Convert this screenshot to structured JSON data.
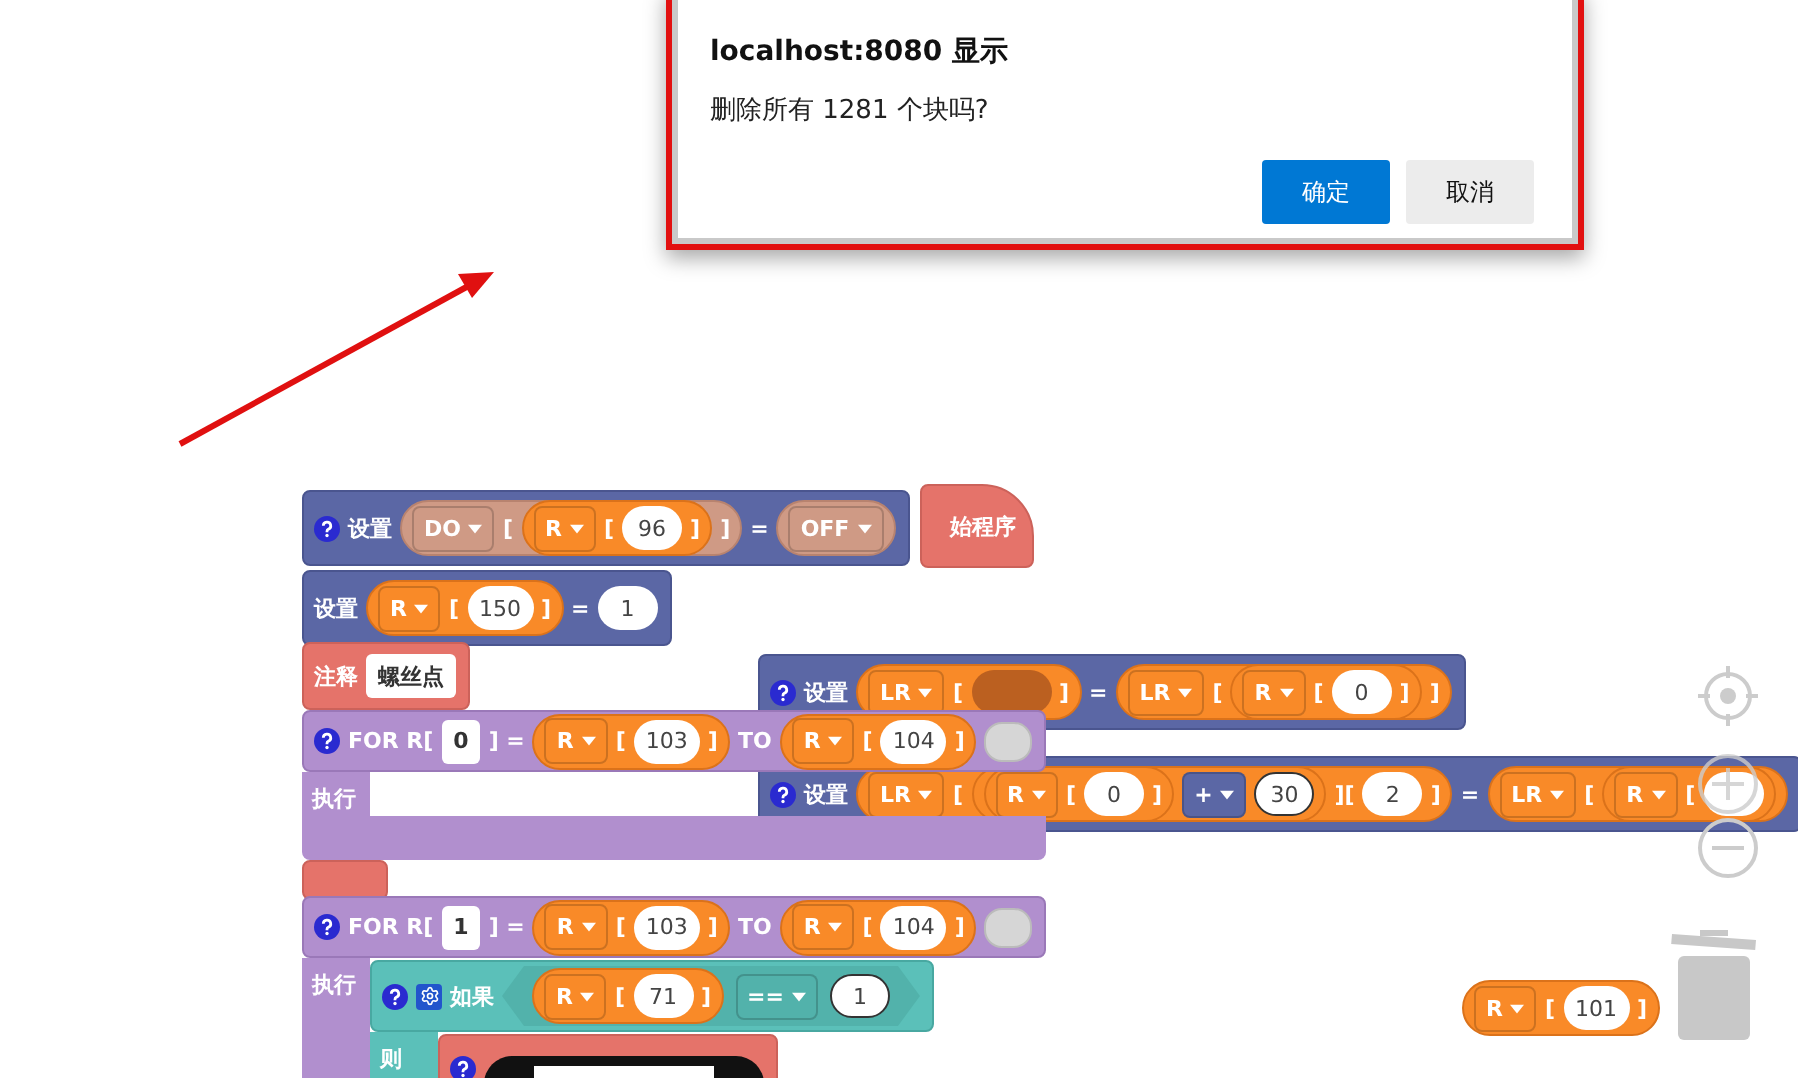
{
  "dialog": {
    "title": "localhost:8080 显示",
    "message": "删除所有 1281 个块吗?",
    "buttons": [
      {
        "label": "确定",
        "primary": true
      },
      {
        "label": "取消",
        "primary": false
      }
    ]
  },
  "blocks": [
    {
      "kind": "variables",
      "help": true,
      "tokens": [
        {
          "kind": "label",
          "text": "设置"
        },
        {
          "kind": "tanreporter",
          "tokens": [
            {
              "kind": "dropdown",
              "text": "DO"
            },
            {
              "kind": "label",
              "text": "["
            },
            {
              "kind": "reporter",
              "tokens": [
                {
                  "kind": "dropdown",
                  "text": "R"
                },
                {
                  "kind": "label",
                  "text": "["
                },
                {
                  "kind": "number",
                  "text": "96"
                },
                {
                  "kind": "label",
                  "text": "]"
                }
              ]
            },
            {
              "kind": "label",
              "text": "]"
            }
          ]
        },
        {
          "kind": "label",
          "text": "="
        },
        {
          "kind": "tanreporter",
          "tokens": [
            {
              "kind": "dropdown",
              "text": "OFF"
            }
          ]
        }
      ]
    },
    {
      "kind": "hat",
      "help": false,
      "tokens": [
        {
          "kind": "label",
          "text": "始程序"
        }
      ]
    },
    {
      "kind": "variables",
      "help": false,
      "tokens": [
        {
          "kind": "label",
          "text": "设置"
        },
        {
          "kind": "reporter",
          "tokens": [
            {
              "kind": "dropdown",
              "text": "R"
            },
            {
              "kind": "label",
              "text": "["
            },
            {
              "kind": "number",
              "text": "150"
            },
            {
              "kind": "label",
              "text": "]"
            }
          ]
        },
        {
          "kind": "label",
          "text": "="
        },
        {
          "kind": "number",
          "text": "1"
        }
      ]
    },
    {
      "kind": "comment",
      "help": false,
      "tokens": [
        {
          "kind": "label",
          "text": "注释"
        },
        {
          "kind": "field",
          "text": "螺丝点"
        }
      ]
    },
    {
      "kind": "variables",
      "help": true,
      "tokens": [
        {
          "kind": "label",
          "text": "设置"
        },
        {
          "kind": "reporter",
          "tokens": [
            {
              "kind": "dropdown",
              "text": "LR"
            },
            {
              "kind": "label",
              "text": "["
            },
            {
              "kind": "hole"
            },
            {
              "kind": "label",
              "text": "]"
            }
          ]
        },
        {
          "kind": "label",
          "text": "="
        },
        {
          "kind": "reporter",
          "tokens": [
            {
              "kind": "dropdown",
              "text": "LR"
            },
            {
              "kind": "label",
              "text": "["
            },
            {
              "kind": "reporter",
              "tokens": [
                {
                  "kind": "dropdown",
                  "text": "R"
                },
                {
                  "kind": "label",
                  "text": "["
                },
                {
                  "kind": "number",
                  "text": "0"
                },
                {
                  "kind": "label",
                  "text": "]"
                }
              ]
            },
            {
              "kind": "label",
              "text": "]"
            }
          ]
        }
      ]
    },
    {
      "kind": "variables",
      "help": true,
      "tokens": [
        {
          "kind": "label",
          "text": "设置"
        },
        {
          "kind": "reporter",
          "tokens": [
            {
              "kind": "dropdown",
              "text": "LR"
            },
            {
              "kind": "label",
              "text": "["
            },
            {
              "kind": "reporter",
              "tokens": [
                {
                  "kind": "reporter",
                  "tokens": [
                    {
                      "kind": "dropdown",
                      "text": "R"
                    },
                    {
                      "kind": "label",
                      "text": "["
                    },
                    {
                      "kind": "number",
                      "text": "0"
                    },
                    {
                      "kind": "label",
                      "text": "]"
                    }
                  ]
                },
                {
                  "kind": "operator",
                  "text": "+"
                },
                {
                  "kind": "number",
                  "text": "30",
                  "ring": true
                }
              ]
            },
            {
              "kind": "label",
              "text": "]["
            },
            {
              "kind": "number",
              "text": "2"
            },
            {
              "kind": "label",
              "text": "]"
            }
          ]
        },
        {
          "kind": "label",
          "text": "="
        },
        {
          "kind": "reporter",
          "tokens": [
            {
              "kind": "dropdown",
              "text": "LR"
            },
            {
              "kind": "label",
              "text": "["
            },
            {
              "kind": "reporter",
              "tokens": [
                {
                  "kind": "dropdown",
                  "text": "R"
                },
                {
                  "kind": "label",
                  "text": "["
                },
                {
                  "kind": "blank"
                }
              ]
            }
          ]
        }
      ]
    },
    {
      "kind": "loop",
      "help": true,
      "tokens": [
        {
          "kind": "label",
          "text": "FOR R["
        },
        {
          "kind": "field",
          "text": "0"
        },
        {
          "kind": "label",
          "text": "] ="
        },
        {
          "kind": "reporter",
          "tokens": [
            {
              "kind": "dropdown",
              "text": "R"
            },
            {
              "kind": "label",
              "text": "["
            },
            {
              "kind": "number",
              "text": "103"
            },
            {
              "kind": "label",
              "text": "]"
            }
          ]
        },
        {
          "kind": "label",
          "text": "TO"
        },
        {
          "kind": "reporter",
          "tokens": [
            {
              "kind": "dropdown",
              "text": "R"
            },
            {
              "kind": "label",
              "text": "["
            },
            {
              "kind": "number",
              "text": "104"
            },
            {
              "kind": "label",
              "text": "]"
            }
          ]
        },
        {
          "kind": "toggle",
          "on": false
        }
      ],
      "slots": [
        {
          "label": "执行"
        }
      ]
    },
    {
      "kind": "stub"
    },
    {
      "kind": "loop",
      "help": true,
      "tokens": [
        {
          "kind": "label",
          "text": "FOR R["
        },
        {
          "kind": "field",
          "text": "1"
        },
        {
          "kind": "label",
          "text": "] ="
        },
        {
          "kind": "reporter",
          "tokens": [
            {
              "kind": "dropdown",
              "text": "R"
            },
            {
              "kind": "label",
              "text": "["
            },
            {
              "kind": "number",
              "text": "103"
            },
            {
              "kind": "label",
              "text": "]"
            }
          ]
        },
        {
          "kind": "label",
          "text": "TO"
        },
        {
          "kind": "reporter",
          "tokens": [
            {
              "kind": "dropdown",
              "text": "R"
            },
            {
              "kind": "label",
              "text": "["
            },
            {
              "kind": "number",
              "text": "104"
            },
            {
              "kind": "label",
              "text": "]"
            }
          ]
        },
        {
          "kind": "toggle",
          "on": false
        }
      ],
      "slots": [
        {
          "label": "执行",
          "blocks": [
            {
              "kind": "logic",
              "help": true,
              "tokens": [
                {
                  "kind": "gear"
                },
                {
                  "kind": "label",
                  "text": "如果"
                },
                {
                  "kind": "condition",
                  "tokens": [
                    {
                      "kind": "reporter",
                      "tokens": [
                        {
                          "kind": "dropdown",
                          "text": "R"
                        },
                        {
                          "kind": "label",
                          "text": "["
                        },
                        {
                          "kind": "number",
                          "text": "71"
                        },
                        {
                          "kind": "label",
                          "text": "]"
                        }
                      ]
                    },
                    {
                      "kind": "comparator",
                      "text": "=="
                    },
                    {
                      "kind": "number",
                      "text": "1",
                      "ring": true
                    }
                  ]
                }
              ],
              "slots": [
                {
                  "label": "则",
                  "blocks": [
                    {
                      "kind": "comment",
                      "help": true,
                      "tokens": [
                        {
                          "kind": "display"
                        }
                      ]
                    }
                  ]
                }
              ]
            }
          ]
        }
      ]
    },
    {
      "kind": "reporter",
      "tokens": [
        {
          "kind": "dropdown",
          "text": "R"
        },
        {
          "kind": "label",
          "text": "["
        },
        {
          "kind": "number",
          "text": "101"
        },
        {
          "kind": "label",
          "text": "]"
        }
      ]
    }
  ]
}
